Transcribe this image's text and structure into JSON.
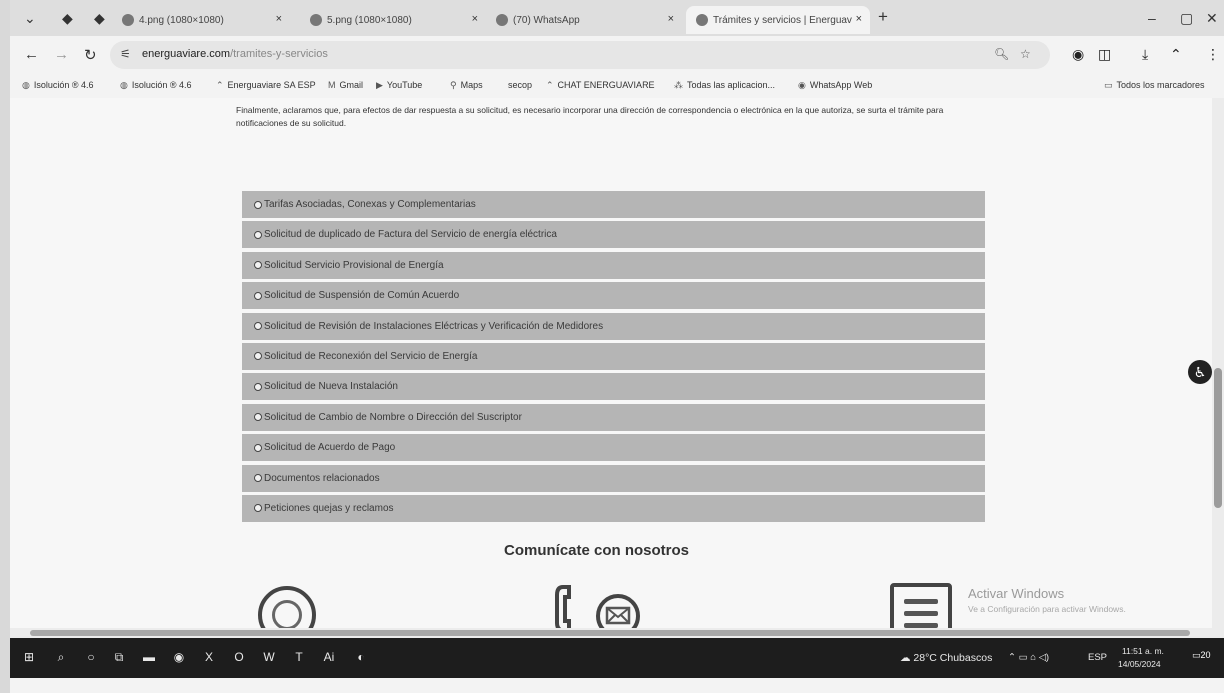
{
  "tabs": [
    {
      "title": "4.png (1080×1080)",
      "close": "×"
    },
    {
      "title": "5.png (1080×1080)",
      "close": "×"
    },
    {
      "title": "(70) WhatsApp",
      "close": "×"
    },
    {
      "title": "Trámites y servicios | Energuav",
      "close": "×"
    }
  ],
  "browser": {
    "new_tab": "+",
    "url_domain": "energuaviare.com",
    "url_path": "/tramites-y-servicios"
  },
  "bookmarks": [
    "Isolución ® 4.6",
    "Isolución ® 4.6",
    "Energuaviare SA ESP",
    "Gmail",
    "YouTube",
    "Maps",
    "secop",
    "CHAT ENERGUAVIARE",
    "Todas las aplicacion...",
    "WhatsApp Web"
  ],
  "bookmarks_all": "Todos los marcadores",
  "intro_text": "Finalmente, aclaramos que, para efectos de dar respuesta a su solicitud, es necesario incorporar una dirección de correspondencia o electrónica en la que autoriza, se surta el trámite para notificaciones de su solicitud.",
  "accordion": [
    "Tarifas Asociadas, Conexas y Complementarias",
    "Solicitud de duplicado de Factura del Servicio de energía eléctrica",
    "Solicitud Servicio Provisional de Energía",
    "Solicitud de Suspensión de Común Acuerdo",
    "Solicitud de Revisión de Instalaciones Eléctricas y Verificación de Medidores",
    "Solicitud de Reconexión del Servicio de Energía",
    "Solicitud de Nueva Instalación",
    "Solicitud de Cambio de Nombre o Dirección del Suscriptor",
    "Solicitud de Acuerdo de Pago",
    "Documentos relacionados",
    "Peticiones quejas y reclamos"
  ],
  "contact_heading": "Comunícate con nosotros",
  "watermark": {
    "title": "Activar Windows",
    "subtitle": "Ve a Configuración para activar Windows."
  },
  "taskbar": {
    "weather": "28°C Chubascos",
    "lang": "ESP",
    "time": "11:51 a. m.",
    "date": "14/05/2024",
    "notif_count": "20"
  }
}
